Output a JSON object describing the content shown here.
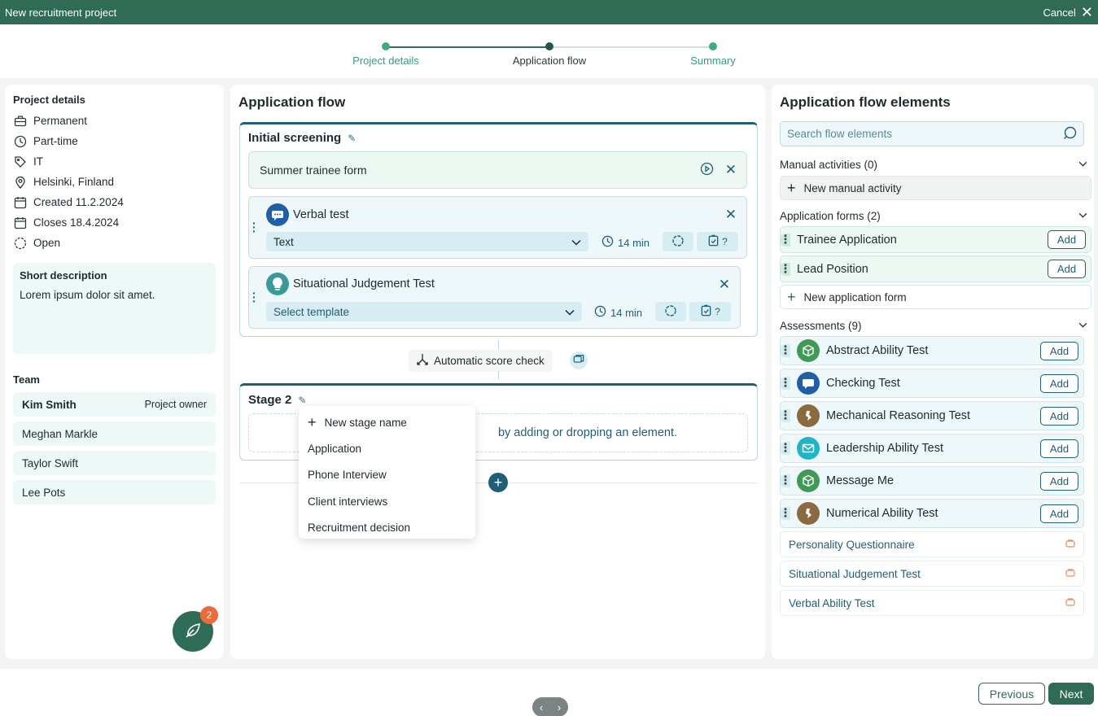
{
  "window": {
    "title": "New recruitment project",
    "cancel_label": "Cancel"
  },
  "stepper": {
    "steps": [
      {
        "label": "Project details",
        "state": "done"
      },
      {
        "label": "Application flow",
        "state": "active"
      },
      {
        "label": "Summary",
        "state": "upcoming"
      }
    ]
  },
  "project_details": {
    "title": "Project details",
    "items": [
      {
        "icon": "briefcase-icon",
        "text": "Permanent"
      },
      {
        "icon": "clock-icon",
        "text": "Part-time"
      },
      {
        "icon": "tag-icon",
        "text": "IT"
      },
      {
        "icon": "location-pin-icon",
        "text": "Helsinki, Finland"
      },
      {
        "icon": "calendar-icon",
        "text": "Created 11.2.2024"
      },
      {
        "icon": "calendar-icon",
        "text": "Closes 18.4.2024"
      },
      {
        "icon": "status-circle-icon",
        "text": "Open"
      }
    ],
    "short_description_title": "Short description",
    "short_description": "Lorem ipsum dolor sit amet.",
    "team_title": "Team",
    "team": [
      {
        "name": "Kim Smith",
        "role": "Project owner"
      },
      {
        "name": "Meghan Markle",
        "role": ""
      },
      {
        "name": "Taylor Swift",
        "role": ""
      },
      {
        "name": "Lee Pots",
        "role": ""
      }
    ],
    "notification_count": "2"
  },
  "application_flow": {
    "title": "Application flow",
    "stage1": {
      "title": "Initial screening",
      "form": "Summer trainee form",
      "tests": [
        {
          "name": "Verbal test",
          "select": "Text",
          "time": "14 min",
          "avatar_color": "#1f5ea8",
          "icon": "chat-bubble-icon"
        },
        {
          "name": "Situational Judgement Test",
          "select": "Select template",
          "time": "14 min",
          "avatar_color": "#3a9a9a",
          "icon": "lightbulb-icon"
        }
      ]
    },
    "auto_check": "Automatic score check",
    "stage2": {
      "title": "Stage 2",
      "drop_text": "by adding or dropping an element."
    },
    "dropdown": {
      "new_label": "New stage name",
      "options": [
        "Application",
        "Phone Interview",
        "Client interviews",
        "Recruitment decision"
      ]
    }
  },
  "elements": {
    "title": "Application flow elements",
    "search_placeholder": "Search flow elements",
    "manual": {
      "title": "Manual activities (0)",
      "new_label": "New manual activity"
    },
    "forms": {
      "title": "Application forms (2)",
      "items": [
        "Trainee Application",
        "Lead Position"
      ],
      "new_label": "New application form"
    },
    "assessments": {
      "title": "Assessments (9)",
      "add_label": "Add",
      "items": [
        {
          "name": "Abstract Ability Test",
          "color": "#3f9a55",
          "icon": "cube-icon"
        },
        {
          "name": "Checking Test",
          "color": "#1f5ea8",
          "icon": "chat-bubble-icon"
        },
        {
          "name": "Mechanical Reasoning Test",
          "color": "#8a6a3f",
          "icon": "gear-person-icon"
        },
        {
          "name": "Leadership Ability Test",
          "color": "#1fb5c8",
          "icon": "envelope-icon"
        },
        {
          "name": "Message Me",
          "color": "#3f9a55",
          "icon": "cube-icon"
        },
        {
          "name": "Numerical Ability Test",
          "color": "#8a6a3f",
          "icon": "gear-person-icon"
        }
      ],
      "locked": [
        "Personality Questionnaire",
        "Situational Judgement Test",
        "Verbal Ability Test"
      ]
    }
  },
  "footer": {
    "previous": "Previous",
    "next": "Next"
  }
}
